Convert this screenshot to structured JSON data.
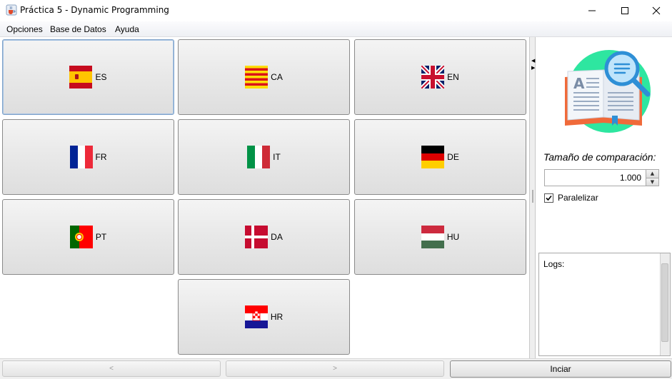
{
  "window": {
    "title": "Práctica 5 - Dynamic Programming",
    "icon": "java-cup-icon",
    "controls": [
      "minimize-icon",
      "maximize-icon",
      "close-icon"
    ]
  },
  "menu": [
    "Opciones",
    "Base de Datos",
    "Ayuda"
  ],
  "languages": [
    {
      "code": "ES",
      "flag": "spain-flag-icon",
      "focused": true
    },
    {
      "code": "CA",
      "flag": "catalonia-flag-icon"
    },
    {
      "code": "EN",
      "flag": "uk-flag-icon"
    },
    {
      "code": "FR",
      "flag": "france-flag-icon"
    },
    {
      "code": "IT",
      "flag": "italy-flag-icon"
    },
    {
      "code": "DE",
      "flag": "germany-flag-icon"
    },
    {
      "code": "PT",
      "flag": "portugal-flag-icon"
    },
    {
      "code": "DA",
      "flag": "denmark-flag-icon"
    },
    {
      "code": "HU",
      "flag": "hungary-flag-icon"
    },
    {
      "code": "HR",
      "flag": "croatia-flag-icon"
    }
  ],
  "side": {
    "size_label": "Tamaño de comparación:",
    "size_value": "1.000",
    "parallel_label": "Paralelizar",
    "parallel_checked": true,
    "logs_label": "Logs:",
    "hero_icon": "dictionary-search-icon"
  },
  "bottom": {
    "prev_label": "<",
    "next_label": ">",
    "start_label": "Inciar"
  },
  "colors": {
    "hero_circle": "#2ee6a0",
    "book_orange": "#f06a3a",
    "magnifier_blue": "#2e8fd6"
  }
}
